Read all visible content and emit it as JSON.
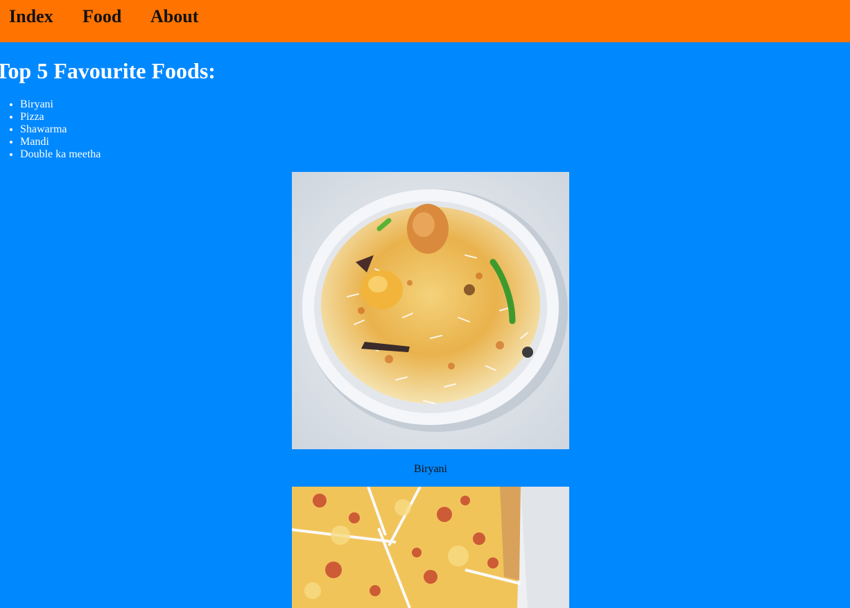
{
  "nav": {
    "items": [
      {
        "label": "Index"
      },
      {
        "label": "Food"
      },
      {
        "label": "About"
      }
    ]
  },
  "main": {
    "title": "Top 5 Favourite Foods:",
    "foods": [
      {
        "label": "Biryani"
      },
      {
        "label": "Pizza"
      },
      {
        "label": "Shawarma"
      },
      {
        "label": "Mandi"
      },
      {
        "label": "Double ka meetha"
      }
    ],
    "gallery": [
      {
        "caption": "Biryani",
        "image": "biryani-photo"
      },
      {
        "caption": "",
        "image": "pizza-photo"
      }
    ]
  },
  "colors": {
    "navbar": "#ff7300",
    "background": "#0088ff",
    "text_light": "#ffffff",
    "text_dark": "#111111"
  }
}
